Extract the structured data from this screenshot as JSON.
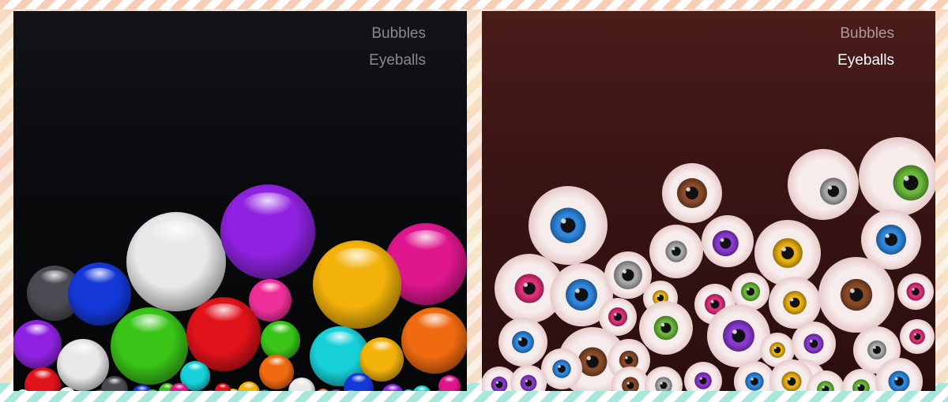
{
  "bubbles_panel": {
    "menu": {
      "bubbles_label": "Bubbles",
      "eyeballs_label": "Eyeballs",
      "selected": "Bubbles"
    },
    "colors": {
      "purple": "#8f22e0",
      "white": "#e8e8e8",
      "magenta": "#e0168f",
      "blue": "#1438d8",
      "gray": "#4a4a52",
      "yellow": "#f2b20a",
      "green": "#3ac418",
      "red": "#e0121a",
      "cyan": "#18d0d8",
      "orange": "#f06a10",
      "pink": "#f0309a"
    },
    "bubble_colors": [
      "gray",
      "blue",
      "white",
      "purple",
      "magenta",
      "yellow",
      "pink",
      "purple",
      "white",
      "green",
      "red",
      "green",
      "cyan",
      "yellow",
      "orange",
      "red",
      "cyan",
      "orange",
      "gray",
      "white",
      "purple",
      "blue",
      "magenta",
      "white",
      "white",
      "gray",
      "blue",
      "green",
      "magenta",
      "red",
      "yellow",
      "yellow",
      "gray",
      "white",
      "orange",
      "purple",
      "blue",
      "orange",
      "cyan",
      "purple",
      "red",
      "magenta",
      "green",
      "cyan",
      "blue"
    ]
  },
  "eyeballs_panel": {
    "menu": {
      "bubbles_label": "Bubbles",
      "eyeballs_label": "Eyeballs",
      "selected": "Eyeballs"
    },
    "colors": {
      "sclera": "#f7ecec",
      "brown": "#8a4a2a",
      "blue": "#2e88e0",
      "gray": "#a8a8a8",
      "green": "#6ab83a",
      "purple": "#8a3ad0",
      "pink": "#e0307a",
      "yellow": "#e8b010"
    },
    "iris_colors": [
      "blue",
      "brown",
      "gray",
      "green",
      "pink",
      "blue",
      "purple",
      "yellow",
      "gray",
      "gray",
      "blue",
      "yellow",
      "pink",
      "green",
      "yellow",
      "brown",
      "pink",
      "blue",
      "brown",
      "pink",
      "green",
      "purple",
      "yellow",
      "purple",
      "gray",
      "pink",
      "green",
      "brown",
      "purple",
      "blue",
      "brown",
      "gray",
      "purple",
      "blue",
      "yellow",
      "green",
      "green",
      "blue",
      "purple"
    ]
  }
}
